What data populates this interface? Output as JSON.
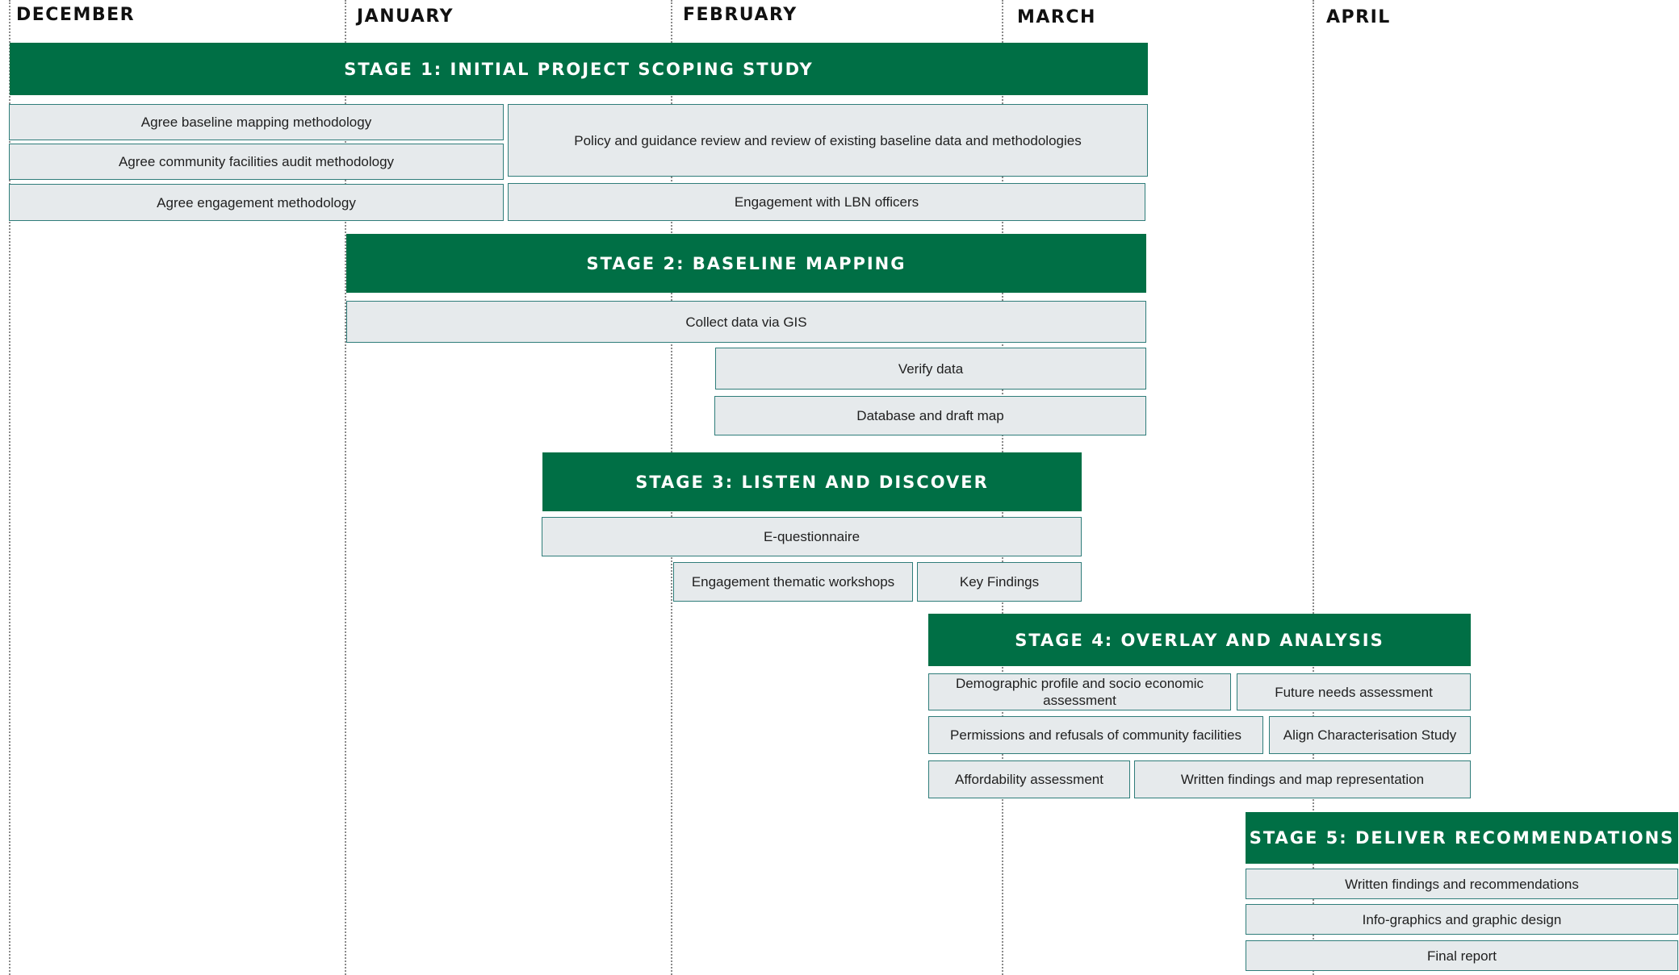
{
  "months": [
    "DECEMBER",
    "JANUARY",
    "FEBRUARY",
    "MARCH",
    "APRIL"
  ],
  "stages": [
    {
      "title": "STAGE 1: INITIAL PROJECT SCOPING STUDY",
      "tasks": [
        "Agree baseline mapping methodology",
        "Agree community facilities audit methodology",
        "Agree engagement methodology",
        "Policy and guidance review and review of existing baseline data and methodologies",
        "Engagement with LBN officers"
      ]
    },
    {
      "title": "STAGE 2: BASELINE MAPPING",
      "tasks": [
        "Collect data via GIS",
        "Verify data",
        "Database and draft map"
      ]
    },
    {
      "title": "STAGE 3: LISTEN AND DISCOVER",
      "tasks": [
        "E-questionnaire",
        "Engagement thematic workshops",
        "Key Findings"
      ]
    },
    {
      "title": "STAGE 4: OVERLAY AND ANALYSIS",
      "tasks": [
        "Demographic profile and socio economic assessment",
        "Future needs assessment",
        "Permissions and refusals of community facilities",
        "Align Characterisation Study",
        "Affordability assessment",
        "Written findings and map representation"
      ]
    },
    {
      "title": "STAGE 5: DELIVER RECOMMENDATIONS",
      "tasks": [
        "Written findings and recommendations",
        "Info-graphics and graphic design",
        "Final report"
      ]
    }
  ],
  "colors": {
    "stage_header": "#006f45",
    "task_fill": "#e6eaec",
    "task_border": "#2f7d7a"
  }
}
